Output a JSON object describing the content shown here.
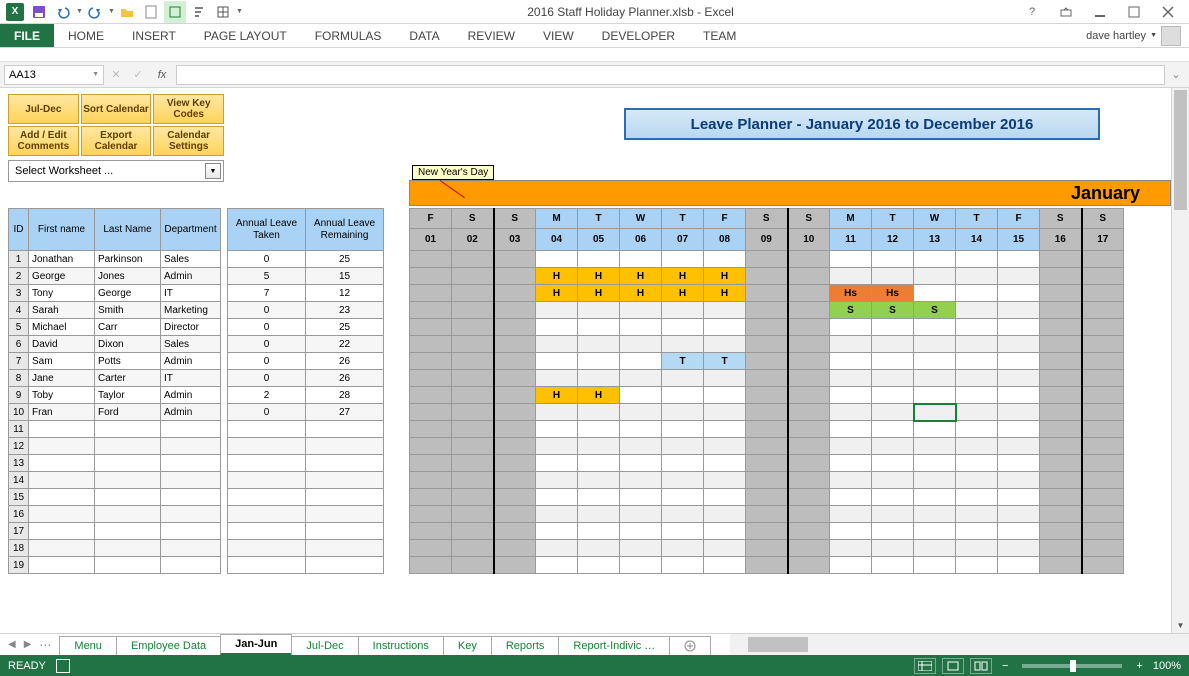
{
  "window": {
    "title": "2016 Staff Holiday Planner.xlsb - Excel",
    "user": "dave hartley"
  },
  "ribbon": {
    "file": "FILE",
    "tabs": [
      "HOME",
      "INSERT",
      "PAGE LAYOUT",
      "FORMULAS",
      "DATA",
      "REVIEW",
      "VIEW",
      "DEVELOPER",
      "TEAM"
    ]
  },
  "formula_bar": {
    "name_box": "AA13",
    "fx_label": "fx",
    "value": ""
  },
  "controls": {
    "buttons": [
      [
        "Jul-Dec",
        "Sort Calendar",
        "View Key Codes"
      ],
      [
        "Add / Edit Comments",
        "Export Calendar",
        "Calendar Settings"
      ]
    ],
    "worksheet_select": "Select Worksheet ..."
  },
  "planner_title": "Leave Planner - January 2016 to December 2016",
  "tooltip": "New Year's Day",
  "month_label": "January",
  "emp_headers": [
    "ID",
    "First name",
    "Last Name",
    "Department",
    "Annual Leave Taken",
    "Annual Leave Remaining"
  ],
  "employees": [
    {
      "id": 1,
      "first": "Jonathan",
      "last": "Parkinson",
      "dept": "Sales",
      "taken": 0,
      "remain": 25
    },
    {
      "id": 2,
      "first": "George",
      "last": "Jones",
      "dept": "Admin",
      "taken": 5,
      "remain": 15
    },
    {
      "id": 3,
      "first": "Tony",
      "last": "George",
      "dept": "IT",
      "taken": 7,
      "remain": 12
    },
    {
      "id": 4,
      "first": "Sarah",
      "last": "Smith",
      "dept": "Marketing",
      "taken": 0,
      "remain": 23
    },
    {
      "id": 5,
      "first": "Michael",
      "last": "Carr",
      "dept": "Director",
      "taken": 0,
      "remain": 25
    },
    {
      "id": 6,
      "first": "David",
      "last": "Dixon",
      "dept": "Sales",
      "taken": 0,
      "remain": 22
    },
    {
      "id": 7,
      "first": "Sam",
      "last": "Potts",
      "dept": "Admin",
      "taken": 0,
      "remain": 26
    },
    {
      "id": 8,
      "first": "Jane",
      "last": "Carter",
      "dept": "IT",
      "taken": 0,
      "remain": 26
    },
    {
      "id": 9,
      "first": "Toby",
      "last": "Taylor",
      "dept": "Admin",
      "taken": 2,
      "remain": 28
    },
    {
      "id": 10,
      "first": "Fran",
      "last": "Ford",
      "dept": "Admin",
      "taken": 0,
      "remain": 27
    }
  ],
  "empty_rows": [
    11,
    12,
    13,
    14,
    15,
    16,
    17,
    18,
    19
  ],
  "calendar": {
    "day_labels": [
      "F",
      "S",
      "S",
      "M",
      "T",
      "W",
      "T",
      "F",
      "S",
      "S",
      "M",
      "T",
      "W",
      "T",
      "F",
      "S",
      "S"
    ],
    "dates": [
      "01",
      "02",
      "03",
      "04",
      "05",
      "06",
      "07",
      "08",
      "09",
      "10",
      "11",
      "12",
      "13",
      "14",
      "15",
      "16",
      "17"
    ],
    "weekend_idx": [
      1,
      2,
      8,
      9,
      15,
      16
    ],
    "selection": {
      "row": 9,
      "col": 12
    },
    "cells": {
      "1-3": "H",
      "1-4": "H",
      "1-5": "H",
      "1-6": "H",
      "1-7": "H",
      "2-3": "H",
      "2-4": "H",
      "2-5": "H",
      "2-6": "H",
      "2-7": "H",
      "2-10": "Hs",
      "2-11": "Hs",
      "3-10": "S",
      "3-11": "S",
      "3-12": "S",
      "6-6": "T",
      "6-7": "T",
      "8-3": "H",
      "8-4": "H"
    }
  },
  "sheet_tabs": {
    "tabs": [
      "Menu",
      "Employee Data",
      "Jan-Jun",
      "Jul-Dec",
      "Instructions",
      "Key",
      "Reports",
      "Report-Indivic …"
    ],
    "active_index": 2
  },
  "status": {
    "ready": "READY",
    "zoom": "100%"
  }
}
